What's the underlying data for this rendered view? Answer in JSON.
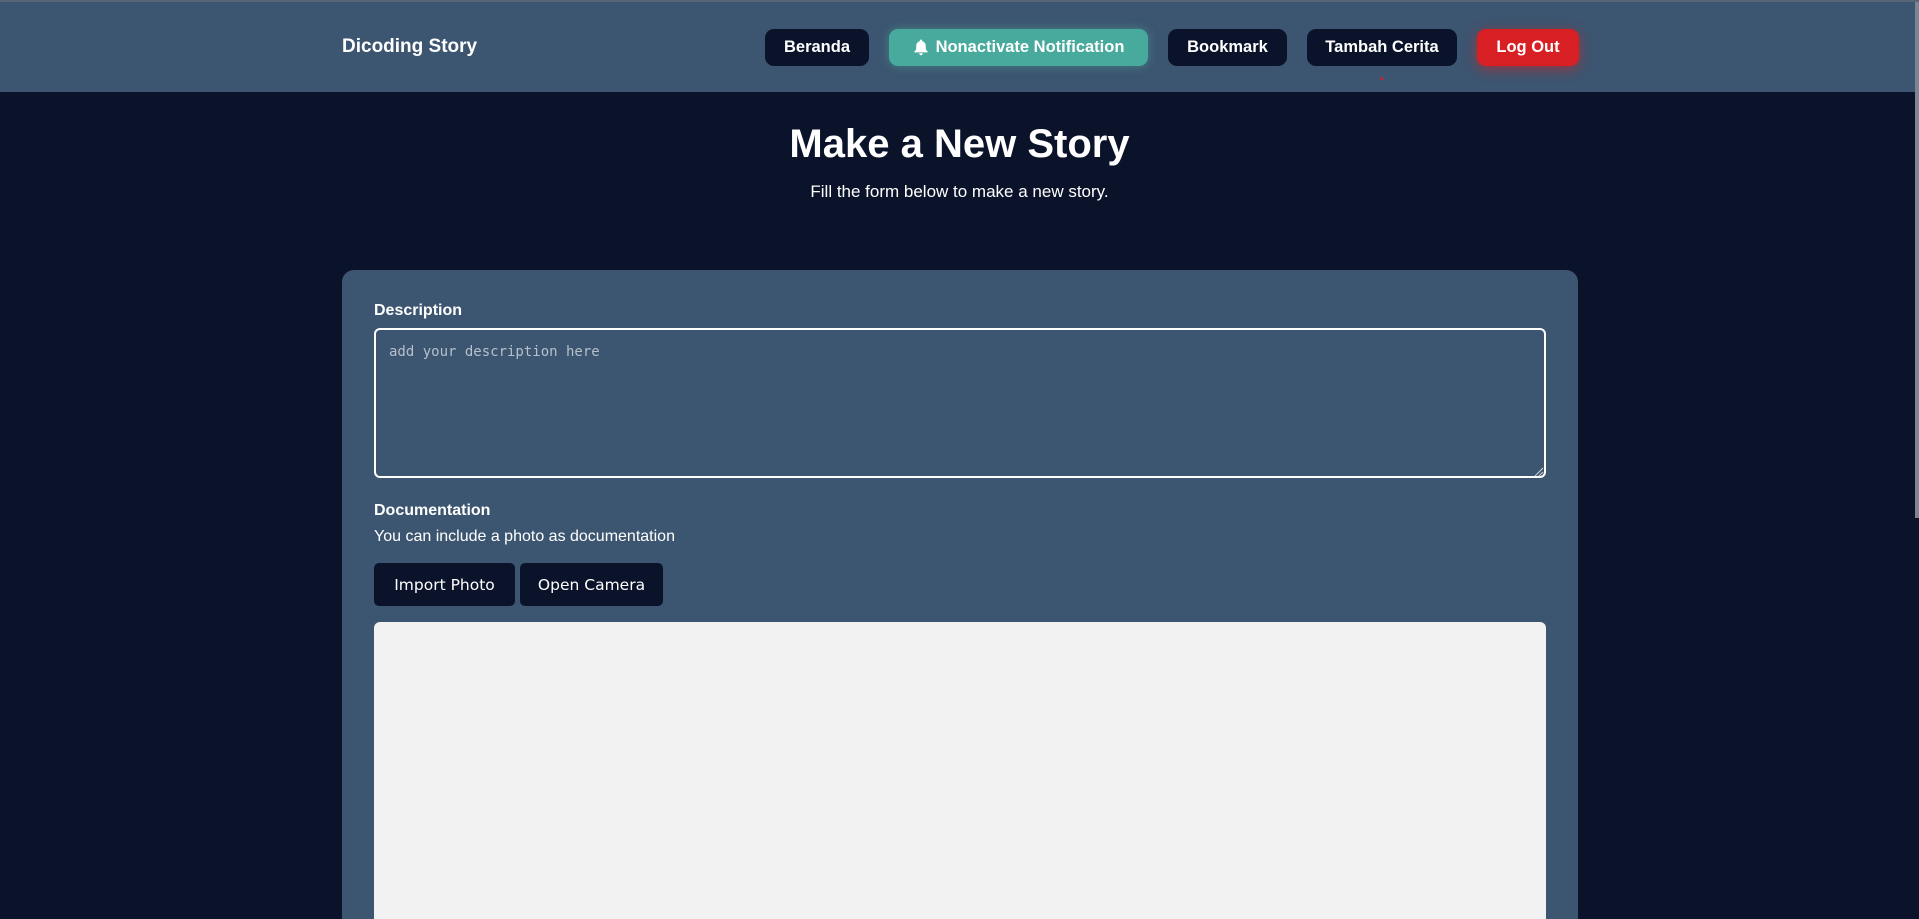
{
  "header": {
    "brand": "Dicoding Story",
    "nav": {
      "home": "Beranda",
      "notification": "Nonactivate Notification",
      "bookmark": "Bookmark",
      "add_story": "Tambah Cerita",
      "logout": "Log Out"
    }
  },
  "page": {
    "title": "Make a New Story",
    "subtitle": "Fill the form below to make a new story."
  },
  "form": {
    "description": {
      "label": "Description",
      "placeholder": "add your description here",
      "value": ""
    },
    "documentation": {
      "label": "Documentation",
      "help": "You can include a photo as documentation",
      "import_label": "Import Photo",
      "camera_label": "Open Camera"
    }
  },
  "icons": {
    "notification": "bell-icon"
  },
  "colors": {
    "background": "#0b132b",
    "header": "#3c5570",
    "card": "#3c5570",
    "notification_button": "#48aa9c",
    "logout_button": "#d81f23",
    "nav_button": "#0b132b",
    "preview_area": "#f2f2f2"
  }
}
